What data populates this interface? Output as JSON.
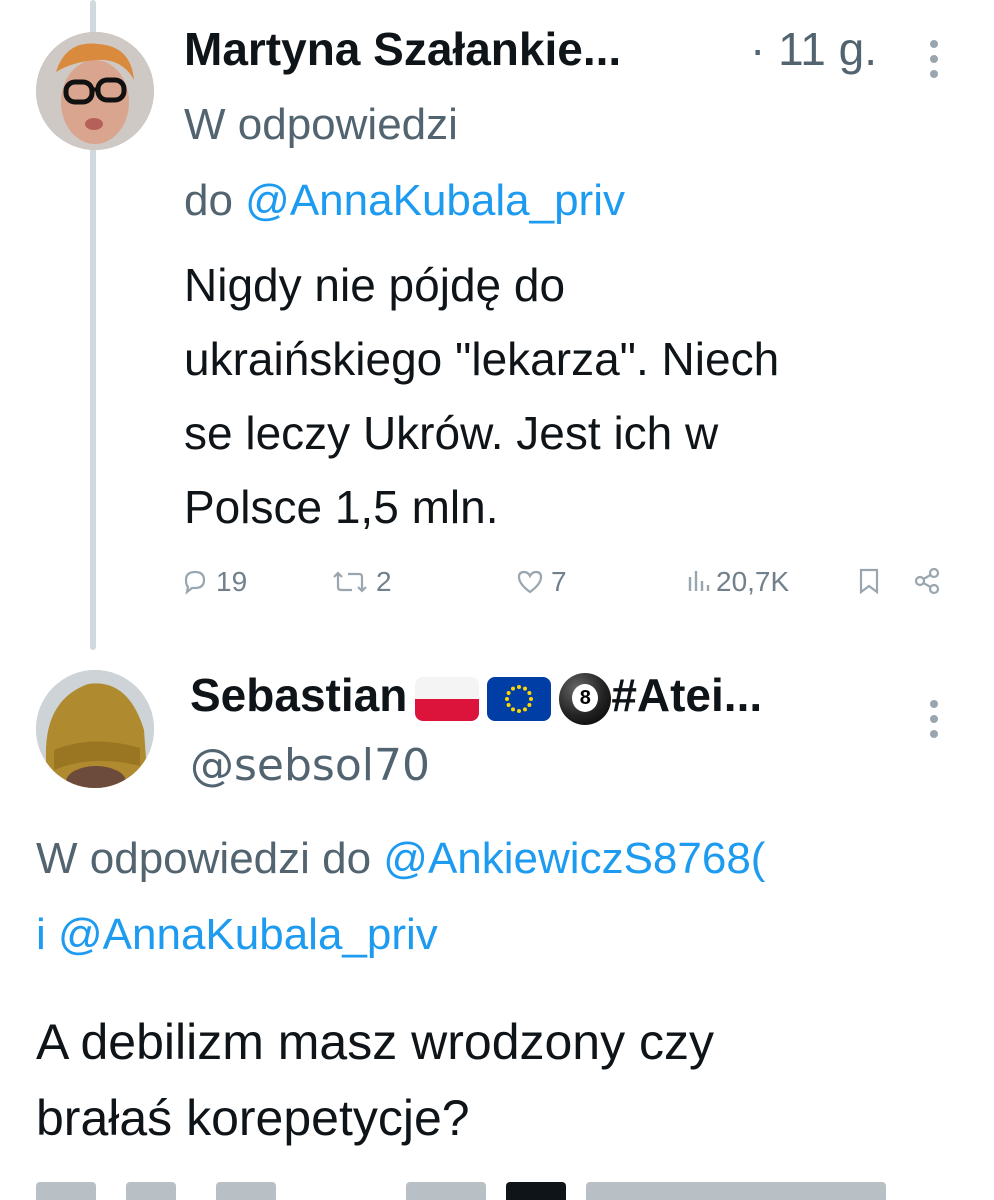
{
  "tweet1": {
    "display_name": "Martyna Szałankie...",
    "time": "· 11 g.",
    "reply_label": "W odpowiedzi",
    "reply_to_prefix": "do ",
    "reply_mention": "@AnnaKubala_priv",
    "text_lines": [
      "Nigdy nie pójdę do",
      "ukraińskiego \"lekarza\". Niech",
      "se leczy Ukrów. Jest ich w",
      "Polsce 1,5 mln."
    ],
    "replies": "19",
    "reposts": "2",
    "likes": "7",
    "views": "20,7K"
  },
  "tweet2": {
    "display_name": "Sebastian",
    "name_suffix": "#Atei...",
    "name_emojis": [
      "flag-poland",
      "flag-eu",
      "pool-8-ball"
    ],
    "ball_number": "8",
    "handle": "@sebsol70",
    "reply_prefix": "W odpowiedzi do ",
    "reply_mention1": "@AnkiewiczS8768(",
    "reply_and": "i ",
    "reply_mention2": "@AnnaKubala_priv",
    "text_lines": [
      "A debilizm masz wrodzony czy",
      "brałaś korepetycje?"
    ]
  },
  "colors": {
    "text": "#0f1419",
    "secondary": "#536471",
    "accent": "#1d9bf0",
    "icon": "#71808b"
  }
}
